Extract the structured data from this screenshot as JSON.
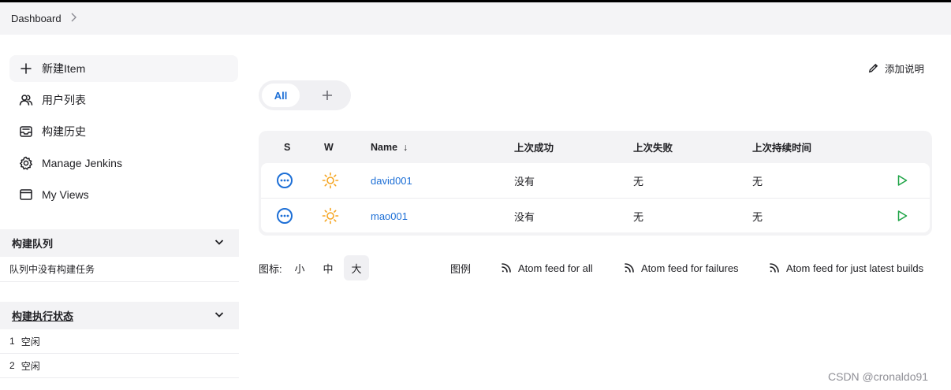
{
  "breadcrumb": {
    "dashboard": "Dashboard"
  },
  "sidebar": {
    "tasks": [
      {
        "label": "新建Item",
        "icon": "plus-icon"
      },
      {
        "label": "用户列表",
        "icon": "users-icon"
      },
      {
        "label": "构建历史",
        "icon": "inbox-icon"
      },
      {
        "label": "Manage Jenkins",
        "icon": "gear-icon"
      },
      {
        "label": "My Views",
        "icon": "window-icon"
      }
    ],
    "build_queue": {
      "title": "构建队列",
      "empty_text": "队列中没有构建任务"
    },
    "executor_status": {
      "title": "构建执行状态",
      "executors": [
        {
          "num": "1",
          "state": "空闲"
        },
        {
          "num": "2",
          "state": "空闲"
        }
      ]
    }
  },
  "main": {
    "add_description": "添加说明",
    "tabs": {
      "all": "All"
    },
    "table": {
      "headers": {
        "s": "S",
        "w": "W",
        "name": "Name",
        "sort_arrow": "↓",
        "last_success": "上次成功",
        "last_failure": "上次失败",
        "last_duration": "上次持续时间"
      },
      "rows": [
        {
          "name": "david001",
          "last_success": "没有",
          "last_failure": "无",
          "last_duration": "无"
        },
        {
          "name": "mao001",
          "last_success": "没有",
          "last_failure": "无",
          "last_duration": "无"
        }
      ]
    },
    "footer": {
      "icon_label": "图标:",
      "sizes": [
        "小",
        "中",
        "大"
      ],
      "legend": "图例",
      "feeds": [
        "Atom feed for all",
        "Atom feed for failures",
        "Atom feed for just latest builds"
      ]
    }
  },
  "watermark": "CSDN @cronaldo91",
  "colors": {
    "link": "#1d6fd6",
    "status_blue": "#1d6fd6",
    "weather_sun": "#f5a623",
    "run_green": "#1ea446"
  }
}
